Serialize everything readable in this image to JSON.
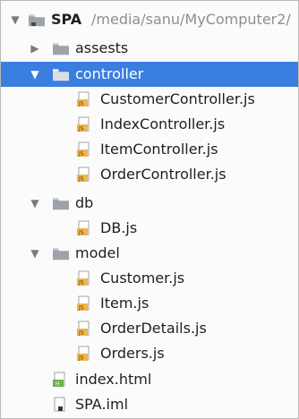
{
  "tree": {
    "root": {
      "name": "SPA",
      "path": "/media/sanu/MyComputer2/"
    },
    "items": [
      {
        "label": "assests",
        "type": "folder",
        "state": "collapsed"
      },
      {
        "label": "controller",
        "type": "folder",
        "state": "expanded",
        "selected": true
      },
      {
        "label": "CustomerController.js",
        "type": "js-file"
      },
      {
        "label": "IndexController.js",
        "type": "js-file"
      },
      {
        "label": "ItemController.js",
        "type": "js-file"
      },
      {
        "label": "OrderController.js",
        "type": "js-file"
      },
      {
        "label": "db",
        "type": "folder",
        "state": "expanded"
      },
      {
        "label": "DB.js",
        "type": "js-file"
      },
      {
        "label": "model",
        "type": "folder",
        "state": "expanded"
      },
      {
        "label": "Customer.js",
        "type": "js-file"
      },
      {
        "label": "Item.js",
        "type": "js-file"
      },
      {
        "label": "OrderDetails.js",
        "type": "js-file"
      },
      {
        "label": "Orders.js",
        "type": "js-file"
      },
      {
        "label": "index.html",
        "type": "html-file"
      },
      {
        "label": "SPA.iml",
        "type": "iml-file"
      }
    ]
  },
  "colors": {
    "selection": "#3a7ee0",
    "folder": "#9da3aa",
    "js_badge": "#f0b44a",
    "html_badge": "#66b34a",
    "path_text": "#8f8f8f"
  },
  "icons": {
    "expanded_arrow": "▼",
    "collapsed_arrow": "▶"
  }
}
